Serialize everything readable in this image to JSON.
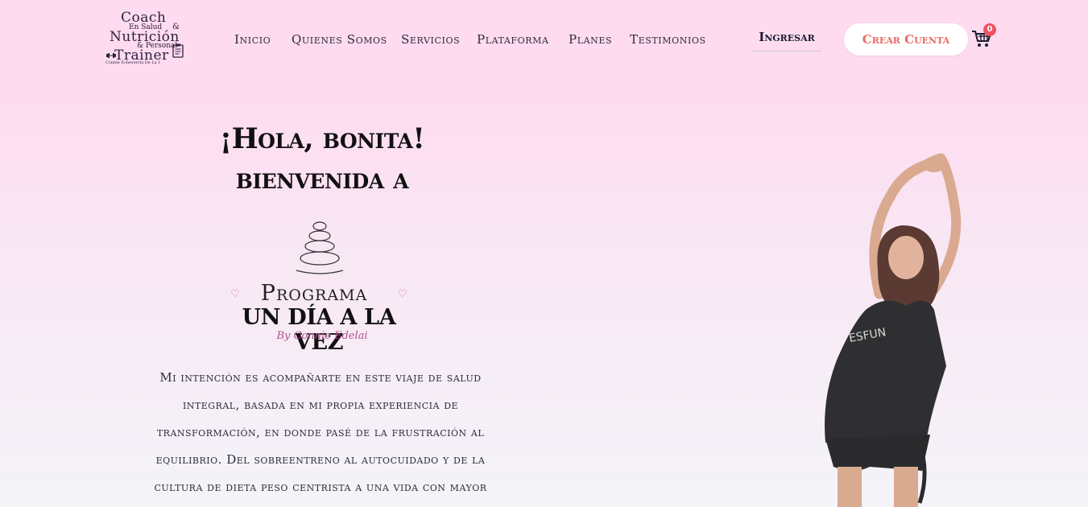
{
  "header": {
    "logo": {
      "line1": "Coach",
      "line2": "En Salud",
      "amp": "&",
      "line3": "Nutrición",
      "line4": "& Personal",
      "line5": "Trainer",
      "line6": "Connie Echeverría De La I."
    },
    "nav": [
      "Inicio",
      "Quienes Somos",
      "Servicios",
      "Plataforma",
      "Planes",
      "Testimonios"
    ],
    "login_label": "Ingresar",
    "signup_label": "Crear Cuenta",
    "cart_count": "0"
  },
  "hero": {
    "title_line1": "¡Hola, bonita!",
    "title_line2": "bienvenida a",
    "program": {
      "word": "Programa",
      "name": "UN DÍA A LA VEZ",
      "by": "By Connie Edelai"
    },
    "paragraph_lines": [
      "Mi intención es acompañarte en este viaje de salud",
      "integral, basada en mi propia experiencia de",
      "transformación, en donde pasé de la frustración al",
      "equilibrio. Del sobreentreno al autocuidado y de la",
      "cultura de dieta peso centrista a una vida con mayor"
    ]
  },
  "colors": {
    "header_bg": "#ffdbf0",
    "accent": "#e86a63",
    "badge": "#f05263",
    "heart": "#d86a9e"
  },
  "icons": [
    "barbell-icon",
    "clipboard-icon",
    "cart-icon",
    "stones-icon",
    "heart-icon"
  ]
}
